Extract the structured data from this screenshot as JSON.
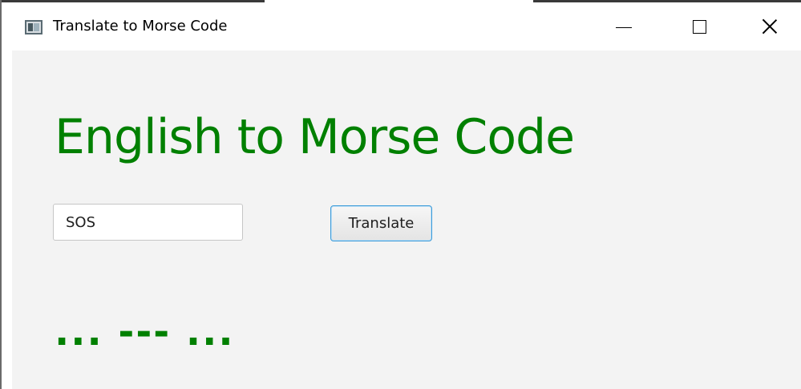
{
  "window": {
    "title": "Translate to Morse Code",
    "icon": "app-window-icon",
    "controls": {
      "minimize": "minimize-icon",
      "maximize": "maximize-icon",
      "close": "close-icon"
    }
  },
  "main": {
    "heading": "English to Morse Code",
    "input_value": "SOS",
    "translate_label": "Translate",
    "output": "... --- ..."
  },
  "colors": {
    "accent_green": "#008000",
    "button_focus_border": "#3d9bd9",
    "window_background": "#f3f3f3"
  }
}
